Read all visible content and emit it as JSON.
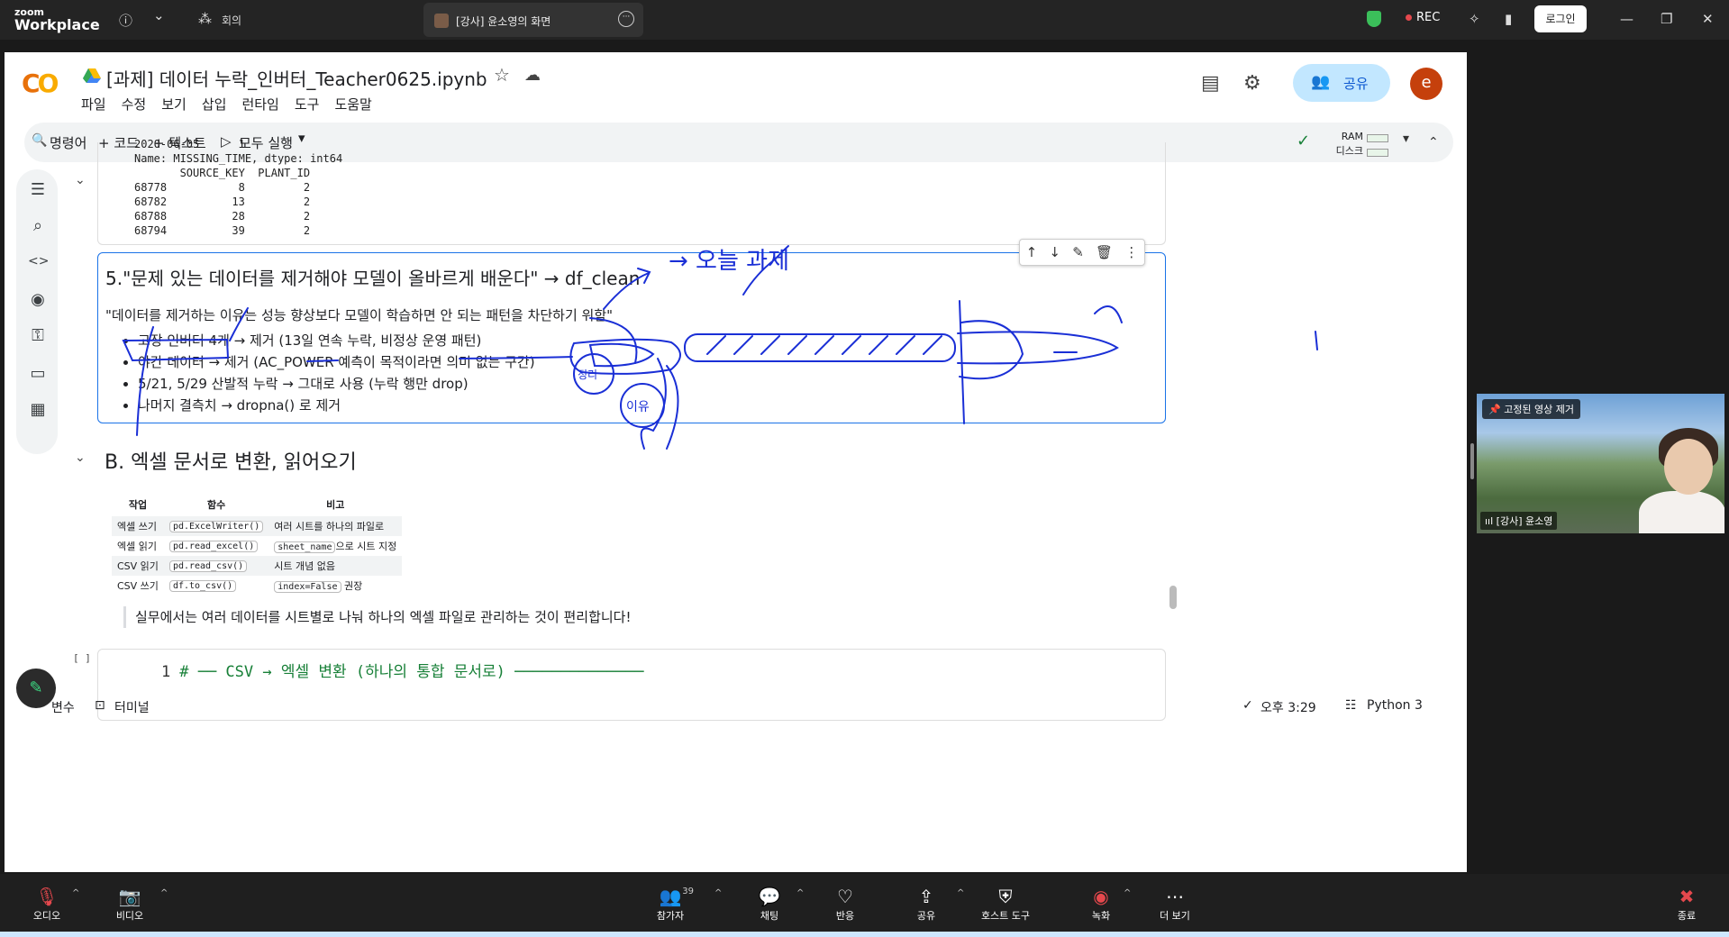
{
  "zoom_top": {
    "logo_small": "zoom",
    "logo_big": "Workplace",
    "info_icon": "ⓘ",
    "chevron": "⌄",
    "meeting_icon": "⁂",
    "meeting_label": "회의",
    "tab_title": "[강사] 윤소영의 화면",
    "tab_more": "···",
    "rec_label": "REC",
    "login_label": "로그인",
    "win_min": "—",
    "win_max": "❐",
    "win_close": "✕"
  },
  "colab": {
    "logo_co": "C",
    "logo_o": "O",
    "notebook_title": "[과제] 데이터 누락_인버터_Teacher0625.ipynb",
    "star": "☆",
    "cloud": "☁",
    "menu": [
      "파일",
      "수정",
      "보기",
      "삽입",
      "런타임",
      "도구",
      "도움말"
    ],
    "share_label": "공유",
    "share_icon": "👥",
    "avatar_letter": "e",
    "comment_icon": "▤",
    "settings_icon": "⚙"
  },
  "toolbar": {
    "command_icon": "🔍",
    "command_label": "명령어",
    "code_label": "+ 코드",
    "text_label": "+ 텍스트",
    "run_all_icon": "▷",
    "run_all_label": "모두 실행",
    "run_all_caret": "▾",
    "check_icon": "✓",
    "ram_label": "RAM",
    "disk_label": "디스크",
    "caret_down": "▾",
    "caret_up": "⌃"
  },
  "sidebar_icons": [
    "☰",
    "⌕",
    "<>",
    "◉",
    "⚿",
    "▭",
    "▦"
  ],
  "output": {
    "text": "2020-06-05      1\nName: MISSING_TIME, dtype: int64\n       SOURCE_KEY  PLANT_ID\n68778           8         2\n68782          13         2\n68788          28         2\n68794          39         2",
    "collapse_icon": "⌄"
  },
  "text_cell": {
    "heading": "5.\"문제 있는 데이터를 제거해야 모델이 올바르게 배운다\" → df_clean",
    "quote": "\"데이터를 제거하는 이유는 성능 향상보다 모델이 학습하면 안 되는 패턴을 차단하기 위함\"",
    "items": [
      "고장 인버터 4개 → 제거 (13일 연속 누락, 비정상 운영 패턴)",
      "야간 데이터 → 제거 (AC_POWER 예측이 목적이라면 의미 없는 구간)",
      "5/21, 5/29 산발적 누락 → 그대로 사용 (누락 행만 drop)",
      "나머지 결측치 → dropna() 로 제거"
    ],
    "tools": [
      "↑",
      "↓",
      "✎",
      "🗑",
      "⋮"
    ]
  },
  "section_b": {
    "collapse_icon": "⌄",
    "heading": "B. 엑셀 문서로 변환, 읽어오기"
  },
  "table": {
    "headers": [
      "작업",
      "함수",
      "비고"
    ],
    "rows": [
      {
        "task": "엑셀 쓰기",
        "func": "pd.ExcelWriter()",
        "note_code": "",
        "note": "여러 시트를 하나의 파일로"
      },
      {
        "task": "엑셀 읽기",
        "func": "pd.read_excel()",
        "note_code": "sheet_name",
        "note": "으로 시트 지정"
      },
      {
        "task": "CSV 읽기",
        "func": "pd.read_csv()",
        "note_code": "",
        "note": "시트 개념 없음"
      },
      {
        "task": "CSV 쓰기",
        "func": "df.to_csv()",
        "note_code": "index=False",
        "note": "권장"
      }
    ]
  },
  "note_text": "실무에서는 여러 데이터를 시트별로 나눠 하나의 엑셀 파일로 관리하는 것이 편리합니다!",
  "code_cell": {
    "exec_count": "[ ]",
    "line_no": "1",
    "code": "# ── CSV → 엑셀 변환 (하나의 통합 문서로) ──────────────"
  },
  "status_bar": {
    "variables_label": "변수",
    "terminal_icon": "⊡",
    "terminal_label": "터미널",
    "check_icon": "✓",
    "time_label": "오후 3:29",
    "python_icon": "☷",
    "python_label": "Python 3",
    "fab_icon": "✎"
  },
  "video_tile": {
    "pin_label": "📌 고정된 영상 제거",
    "name_label": "ııl [강사] 윤소영"
  },
  "zoom_bottom": {
    "audio_label": "오디오",
    "video_label": "비디오",
    "participants_label": "참가자",
    "participants_count": "39",
    "chat_label": "채팅",
    "reactions_label": "반응",
    "share_label": "공유",
    "host_tools_label": "호스트 도구",
    "record_label": "녹화",
    "more_label": "더 보기",
    "end_label": "종료",
    "caret": "^",
    "audio_icon": "🎙",
    "video_icon": "📷",
    "participants_icon": "👥",
    "chat_icon": "💬",
    "reactions_icon": "♡",
    "share_icon": "⇪",
    "host_icon": "⛨",
    "record_icon": "◉",
    "more_icon": "⋯",
    "end_icon": "✖"
  },
  "annotations": {
    "handwritten": "→ 오늘 과제",
    "circle_note": "정리",
    "reason_note": "이유"
  }
}
